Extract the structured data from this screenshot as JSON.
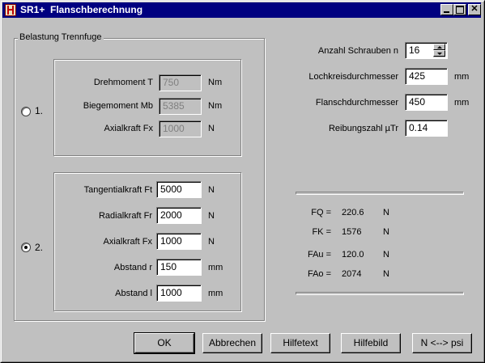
{
  "window": {
    "title": "SR1+  Flanschberechnung"
  },
  "load_group": {
    "title": "Belastung Trennfuge",
    "option1": {
      "label": "1.",
      "selected": false,
      "fields": [
        {
          "label": "Drehmoment T",
          "value": "750",
          "unit": "Nm"
        },
        {
          "label": "Biegemoment Mb",
          "value": "5385",
          "unit": "Nm"
        },
        {
          "label": "Axialkraft Fx",
          "value": "1000",
          "unit": "N"
        }
      ]
    },
    "option2": {
      "label": "2.",
      "selected": true,
      "fields": [
        {
          "label": "Tangentialkraft Ft",
          "value": "5000",
          "unit": "N"
        },
        {
          "label": "Radialkraft Fr",
          "value": "2000",
          "unit": "N"
        },
        {
          "label": "Axialkraft Fx",
          "value": "1000",
          "unit": "N"
        },
        {
          "label": "Abstand r",
          "value": "150",
          "unit": "mm"
        },
        {
          "label": "Abstand l",
          "value": "1000",
          "unit": "mm"
        }
      ]
    }
  },
  "params": [
    {
      "label": "Anzahl Schrauben n",
      "value": "16",
      "unit": ""
    },
    {
      "label": "Lochkreisdurchmesser",
      "value": "425",
      "unit": "mm"
    },
    {
      "label": "Flanschdurchmesser",
      "value": "450",
      "unit": "mm"
    },
    {
      "label": "Reibungszahl µTr",
      "value": "0.14",
      "unit": ""
    }
  ],
  "results": [
    {
      "label": "FQ =",
      "value": "220.6",
      "unit": "N"
    },
    {
      "label": "FK =",
      "value": "1576",
      "unit": "N"
    },
    {
      "label": "FAu =",
      "value": "120.0",
      "unit": "N"
    },
    {
      "label": "FAo =",
      "value": "2074",
      "unit": "N"
    }
  ],
  "buttons": {
    "ok": "OK",
    "cancel": "Abbrechen",
    "helptext": "Hilfetext",
    "helpimage": "Hilfebild",
    "units": "N <--> psi"
  }
}
